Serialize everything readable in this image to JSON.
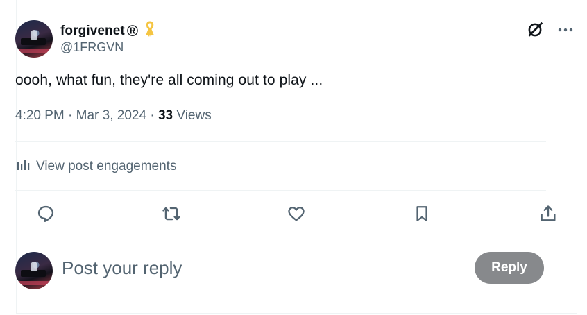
{
  "author": {
    "display_name": "forgivenet",
    "registered_mark": "®",
    "handle": "@1FRGVN"
  },
  "post": {
    "text": "oooh, what fun, they're all coming out to play ...",
    "time": "4:20 PM",
    "separator1": " · ",
    "date": "Mar 3, 2024",
    "separator2": " · ",
    "views_count": "33",
    "views_label": " Views"
  },
  "engagements": {
    "label": "View post engagements"
  },
  "actions": [
    "reply-icon",
    "repost-icon",
    "like-icon",
    "bookmark-icon",
    "share-icon"
  ],
  "composer": {
    "placeholder": "Post your reply",
    "reply_button": "Reply"
  },
  "colors": {
    "text": "#0f1419",
    "secondary": "#536471",
    "divider": "#eff3f4",
    "reply_button_bg": "#87898c",
    "ribbon": "#f5c542"
  }
}
